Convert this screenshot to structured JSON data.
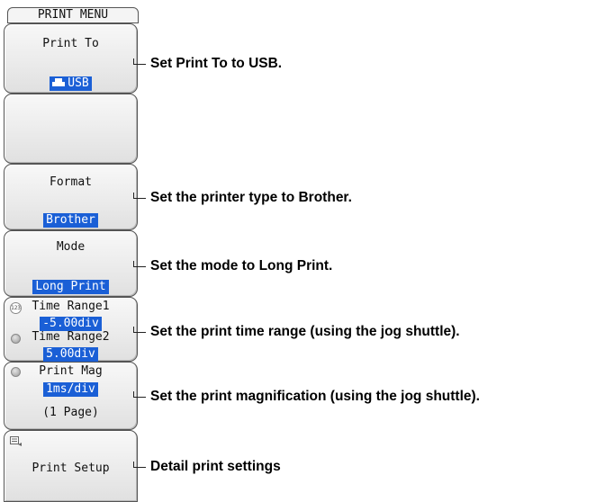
{
  "menu": {
    "title": "PRINT MENU",
    "print_to": {
      "label": "Print To",
      "value": "USB",
      "icon": "printer-icon"
    },
    "format": {
      "label": "Format",
      "value": "Brother"
    },
    "mode": {
      "label": "Mode",
      "value": "Long Print"
    },
    "time_range": {
      "label1": "Time Range1",
      "value1": "-5.00div",
      "label2": "Time Range2",
      "value2": "5.00div",
      "icon": "jog-shuttle-icon"
    },
    "print_mag": {
      "label": "Print Mag",
      "value": "1ms/div",
      "pages": "(1 Page)"
    },
    "print_setup": {
      "label": "Print Setup",
      "icon": "setup-icon"
    }
  },
  "annotations": {
    "print_to": "Set Print To to USB.",
    "format": "Set the printer type to Brother.",
    "mode": "Set the mode to Long Print.",
    "time_range": "Set the print time range (using the jog shuttle).",
    "print_mag": "Set the print magnification (using the jog shuttle).",
    "print_setup": "Detail print settings"
  }
}
